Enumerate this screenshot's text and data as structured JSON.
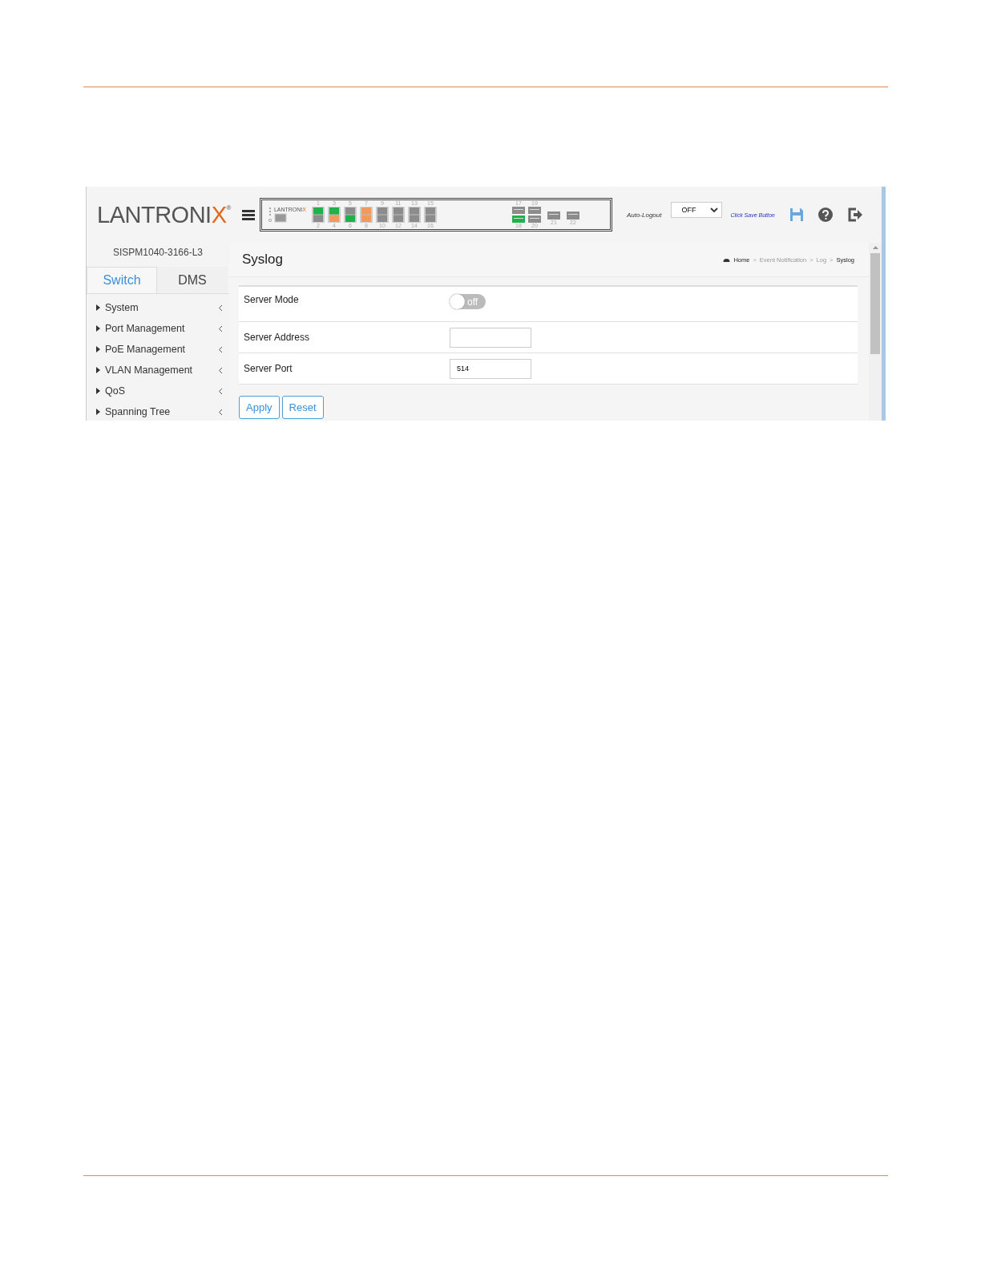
{
  "header": {
    "logo": {
      "text": "LANTRONI",
      "accent": "X",
      "mark": "®"
    },
    "panel": {
      "logo": {
        "text": "LANTRONI",
        "accent": "X"
      },
      "ports": [
        {
          "kind": "rj45",
          "halves": [
            {
              "label": "1",
              "color": "#22b04b"
            },
            {
              "label": "2",
              "color": "#8c8c8c"
            }
          ]
        },
        {
          "kind": "rj45",
          "halves": [
            {
              "label": "3",
              "color": "#22b04b"
            },
            {
              "label": "4",
              "color": "#f39a5a"
            }
          ]
        },
        {
          "kind": "rj45",
          "halves": [
            {
              "label": "5",
              "color": "#8c8c8c"
            },
            {
              "label": "6",
              "color": "#22b04b"
            }
          ]
        },
        {
          "kind": "rj45",
          "halves": [
            {
              "label": "7",
              "color": "#f39a5a"
            },
            {
              "label": "8",
              "color": "#f39a5a"
            }
          ]
        },
        {
          "kind": "rj45",
          "halves": [
            {
              "label": "9",
              "color": "#8c8c8c"
            },
            {
              "label": "10",
              "color": "#8c8c8c"
            }
          ]
        },
        {
          "kind": "rj45",
          "halves": [
            {
              "label": "11",
              "color": "#8c8c8c"
            },
            {
              "label": "12",
              "color": "#8c8c8c"
            }
          ]
        },
        {
          "kind": "rj45",
          "halves": [
            {
              "label": "13",
              "color": "#8c8c8c"
            },
            {
              "label": "14",
              "color": "#8c8c8c"
            }
          ]
        },
        {
          "kind": "rj45",
          "halves": [
            {
              "label": "15",
              "color": "#8c8c8c"
            },
            {
              "label": "16",
              "color": "#8c8c8c"
            }
          ]
        },
        {
          "kind": "sfp",
          "halves": [
            {
              "label": "17",
              "color": "#8c8c8c"
            },
            {
              "label": "18",
              "color": "#22b04b"
            }
          ]
        },
        {
          "kind": "sfp",
          "halves": [
            {
              "label": "19",
              "color": "#8c8c8c"
            },
            {
              "label": "20",
              "color": "#8c8c8c"
            }
          ]
        },
        {
          "kind": "single",
          "halves": [
            {
              "label": "21",
              "color": "#8c8c8c"
            }
          ]
        },
        {
          "kind": "single",
          "halves": [
            {
              "label": "22",
              "color": "#8c8c8c"
            }
          ]
        }
      ]
    },
    "auto_logout": {
      "label": "Auto-Logout",
      "value": "OFF"
    },
    "save_hint": "Click Save Button"
  },
  "sidebar": {
    "device": "SISPM1040-3166-L3",
    "tabs": [
      {
        "label": "Switch",
        "selected": true
      },
      {
        "label": "DMS",
        "selected": false
      }
    ],
    "items": [
      "System",
      "Port Management",
      "PoE Management",
      "VLAN Management",
      "QoS",
      "Spanning Tree"
    ]
  },
  "page": {
    "title": "Syslog",
    "breadcrumb": [
      "Home",
      "Event Notification",
      "Log",
      "Syslog"
    ],
    "breadcrumb_separator": ">",
    "fields": [
      {
        "kind": "toggle",
        "label": "Server Mode",
        "on": false,
        "text": "off"
      },
      {
        "kind": "input",
        "label": "Server Address"
      },
      {
        "kind": "input",
        "label": "Server Port",
        "value": "514"
      }
    ],
    "buttons": [
      "Apply",
      "Reset"
    ]
  }
}
